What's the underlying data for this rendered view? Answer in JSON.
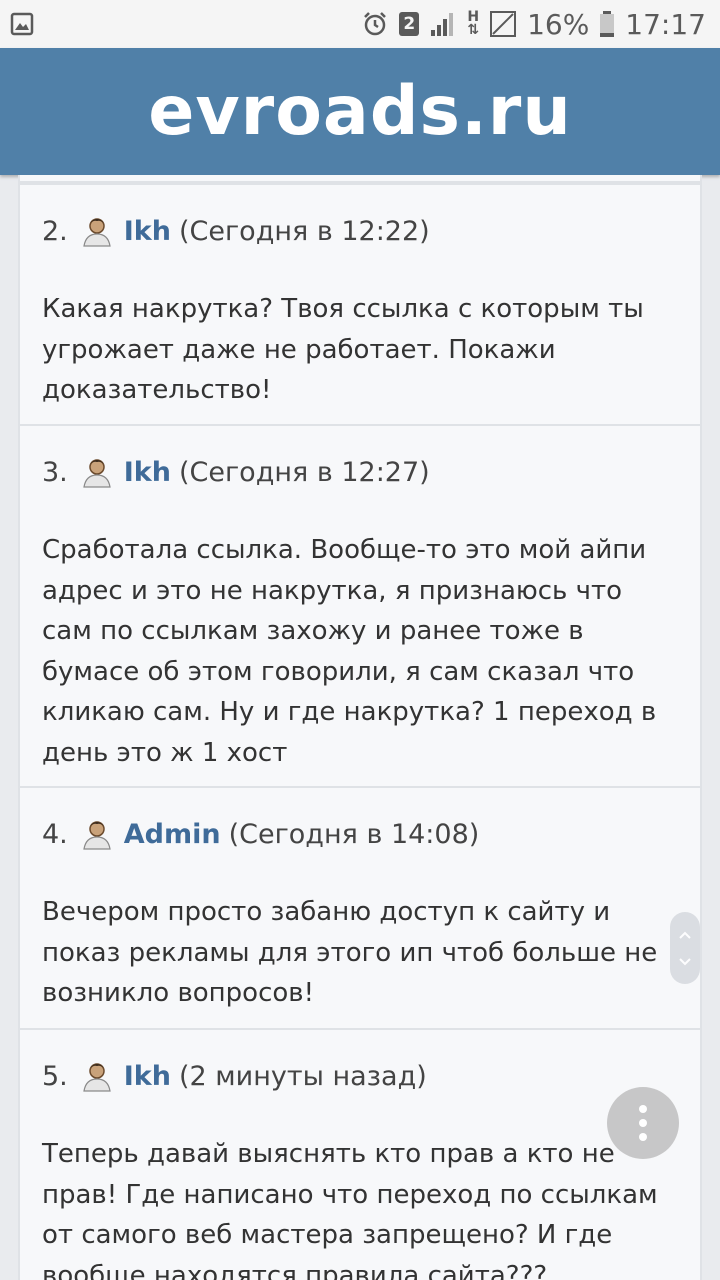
{
  "status_bar": {
    "sim_slot": "2",
    "network_type": "H",
    "battery_percent": "16%",
    "time": "17:17",
    "icons": [
      "image-notification-icon",
      "alarm-icon",
      "signal-icon",
      "hplus-data-icon",
      "no-sim-signal-icon",
      "battery-icon"
    ]
  },
  "header": {
    "site_title": "evroads.ru"
  },
  "colors": {
    "header_bg": "#5080a8",
    "username": "#3f6b99",
    "card_bg": "#f7f8fa"
  },
  "comments": [
    {
      "number": "2.",
      "user": "Ikh",
      "time": "(Сегодня в 12:22)",
      "text": "Какая накрутка? Твоя ссылка с которым ты угрожает даже не работает. Покажи доказательство!"
    },
    {
      "number": "3.",
      "user": "Ikh",
      "time": "(Сегодня в 12:27)",
      "text": "Сработала ссылка. Вообще-то это мой айпи адрес и это не накрутка, я признаюсь что сам по ссылкам захожу и ранее тоже в бумасе об этом говорили, я сам сказал что кликаю сам. Ну и где накрутка? 1 переход в день это ж 1 хост"
    },
    {
      "number": "4.",
      "user": "Admin",
      "time": "(Сегодня в 14:08)",
      "text": "Вечером просто забаню доступ к сайту и показ рекламы для этого ип чтоб больше не возникло вопросов!"
    },
    {
      "number": "5.",
      "user": "Ikh",
      "time": "(2 минуты назад)",
      "text": "Теперь давай выяснять кто прав а кто не прав! Где написано что переход по ссылкам от самого веб мастера запрещено? И где вообще находятся правила сайта???"
    }
  ]
}
